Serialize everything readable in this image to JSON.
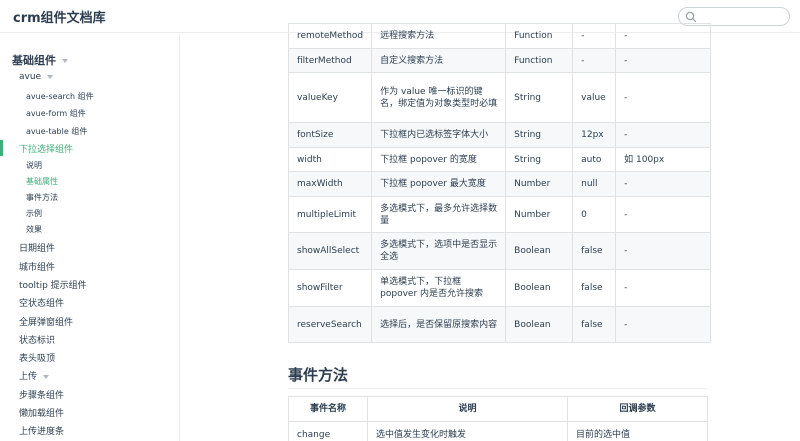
{
  "header": {
    "site_name": "crm组件文档库",
    "search": {
      "placeholder": ""
    }
  },
  "sidebar": {
    "group_title": "基础组件",
    "items": [
      {
        "label": "avue",
        "level": 1,
        "caret": true
      },
      {
        "label": "avue-search 组件",
        "level": 2
      },
      {
        "label": "avue-form 组件",
        "level": 2
      },
      {
        "label": "avue-table 组件",
        "level": 2
      },
      {
        "label": "下拉选择组件",
        "level": 1,
        "active": true
      },
      {
        "label": "说明",
        "level": 2
      },
      {
        "label": "基础属性",
        "level": 2,
        "active": true
      },
      {
        "label": "事件方法",
        "level": 2
      },
      {
        "label": "示例",
        "level": 2
      },
      {
        "label": "效果",
        "level": 2
      },
      {
        "label": "日期组件",
        "level": 1
      },
      {
        "label": "城市组件",
        "level": 1
      },
      {
        "label": "tooltip 提示组件",
        "level": 1
      },
      {
        "label": "空状态组件",
        "level": 1
      },
      {
        "label": "全屏弹窗组件",
        "level": 1
      },
      {
        "label": "状态标识",
        "level": 1
      },
      {
        "label": "表头吸顶",
        "level": 1
      },
      {
        "label": "上传",
        "level": 1,
        "caret": true
      },
      {
        "label": "步骤条组件",
        "level": 1
      },
      {
        "label": "懒加载组件",
        "level": 1
      },
      {
        "label": "上传进度条",
        "level": 1
      }
    ]
  },
  "props_table": {
    "rows": [
      [
        "remoteMethod",
        "远程搜索方法",
        "Function",
        "-",
        "-"
      ],
      [
        "filterMethod",
        "自定义搜索方法",
        "Function",
        "-",
        "-"
      ],
      [
        "valueKey",
        "作为 value 唯一标识的键名，绑定值为对象类型时必填",
        "String",
        "value",
        "-"
      ],
      [
        "fontSize",
        "下拉框内已选标签字体大小",
        "String",
        "12px",
        "-"
      ],
      [
        "width",
        "下拉框 popover 的宽度",
        "String",
        "auto",
        "如 100px"
      ],
      [
        "maxWidth",
        "下拉框 popover 最大宽度",
        "Number",
        "null",
        "-"
      ],
      [
        "multipleLimit",
        "多选模式下，最多允许选择数量",
        "Number",
        "0",
        "-"
      ],
      [
        "showAllSelect",
        "多选模式下，选项中是否显示全选",
        "Boolean",
        "false",
        "-"
      ],
      [
        "showFilter",
        "单选模式下，下拉框 popover 内是否允许搜索",
        "Boolean",
        "false",
        "-"
      ],
      [
        "reserveSearch",
        "选择后，是否保留原搜索内容",
        "Boolean",
        "false",
        "-"
      ]
    ]
  },
  "events_section": {
    "title": "事件方法",
    "headers": [
      "事件名称",
      "说明",
      "回调参数"
    ],
    "rows": [
      [
        "change",
        "选中值发生变化时触发",
        "目前的选中值"
      ]
    ]
  }
}
